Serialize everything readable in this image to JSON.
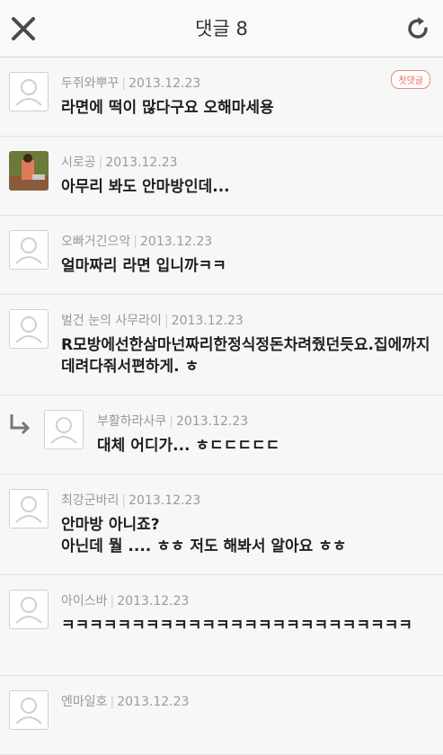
{
  "header": {
    "title": "댓글 8",
    "close_icon": "close-icon",
    "refresh_icon": "refresh-icon"
  },
  "comments": [
    {
      "name": "두쥐와뿌꾸",
      "date": "2013.12.23",
      "text": "라면에 떡이 많다구요 오해마세용",
      "badge": "첫댓글",
      "avatar": "default"
    },
    {
      "name": "시로공",
      "date": "2013.12.23",
      "text": "아무리 봐도 안마방인데...",
      "avatar": "photo"
    },
    {
      "name": "오빠거긴으악",
      "date": "2013.12.23",
      "text": "얼마짜리 라면 입니까ㅋㅋ",
      "avatar": "default"
    },
    {
      "name": "벌건 눈의 사무라이",
      "date": "2013.12.23",
      "text": "R모방에선한삼마넌짜리한정식정돈차려줬던듯요.집에까지 데려다줘서편하게. ㅎ",
      "avatar": "default"
    },
    {
      "name": "부활하라사쿠",
      "date": "2013.12.23",
      "text": "대체 어디가... ㅎㄷㄷㄷㄷㄷ",
      "avatar": "default",
      "reply": true
    },
    {
      "name": "최강군바리",
      "date": "2013.12.23",
      "text": "안마방 아니죠?\n아닌데 뭘 .... ㅎㅎ 저도 해봐서 알아요 ㅎㅎ",
      "avatar": "default"
    },
    {
      "name": "아이스바",
      "date": "2013.12.23",
      "text": "ㅋㅋㅋㅋㅋㅋㅋㅋㅋㅋㅋㅋㅋㅋㅋㅋㅋㅋㅋㅋㅋㅋㅋㅋㅋ",
      "avatar": "default"
    },
    {
      "name": "엔마일호",
      "date": "2013.12.23",
      "text": "",
      "avatar": "default"
    }
  ]
}
